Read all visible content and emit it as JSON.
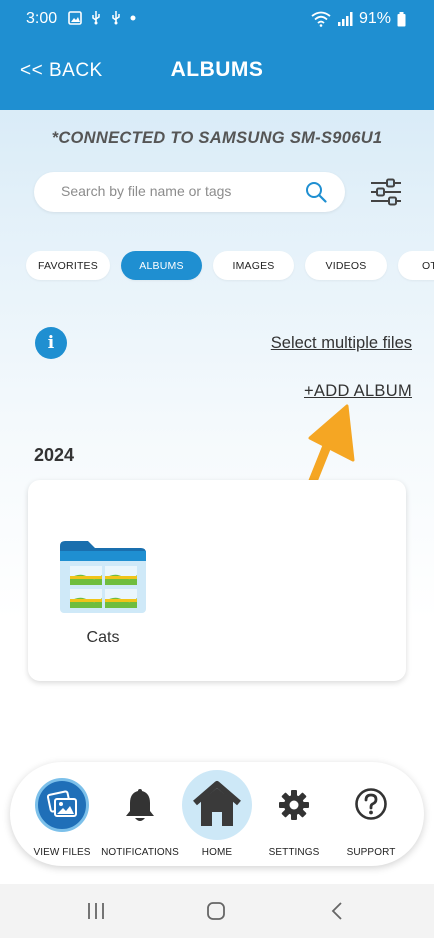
{
  "status_bar": {
    "time": "3:00",
    "battery": "91%"
  },
  "header": {
    "back_label": "<< BACK",
    "title": "ALBUMS"
  },
  "connection": {
    "text": "*CONNECTED TO SAMSUNG SM-S906U1"
  },
  "search": {
    "placeholder": "Search by file name or tags",
    "value": ""
  },
  "tabs": [
    {
      "label": "FAVORITES",
      "active": false
    },
    {
      "label": "ALBUMS",
      "active": true
    },
    {
      "label": "IMAGES",
      "active": false
    },
    {
      "label": "VIDEOS",
      "active": false
    },
    {
      "label": "OT",
      "active": false
    }
  ],
  "actions": {
    "select_multiple": "Select multiple files",
    "add_album": "+ADD ALBUM"
  },
  "albums": {
    "year": "2024",
    "items": [
      {
        "name": "Cats"
      }
    ]
  },
  "bottom_nav": [
    {
      "label": "VIEW FILES",
      "icon": "photos-icon"
    },
    {
      "label": "NOTIFICATIONS",
      "icon": "bell-icon"
    },
    {
      "label": "HOME",
      "icon": "home-icon"
    },
    {
      "label": "SETTINGS",
      "icon": "gear-icon"
    },
    {
      "label": "SUPPORT",
      "icon": "question-icon"
    }
  ],
  "colors": {
    "primary": "#1f8fd1",
    "annotation_arrow": "#f5a623"
  }
}
